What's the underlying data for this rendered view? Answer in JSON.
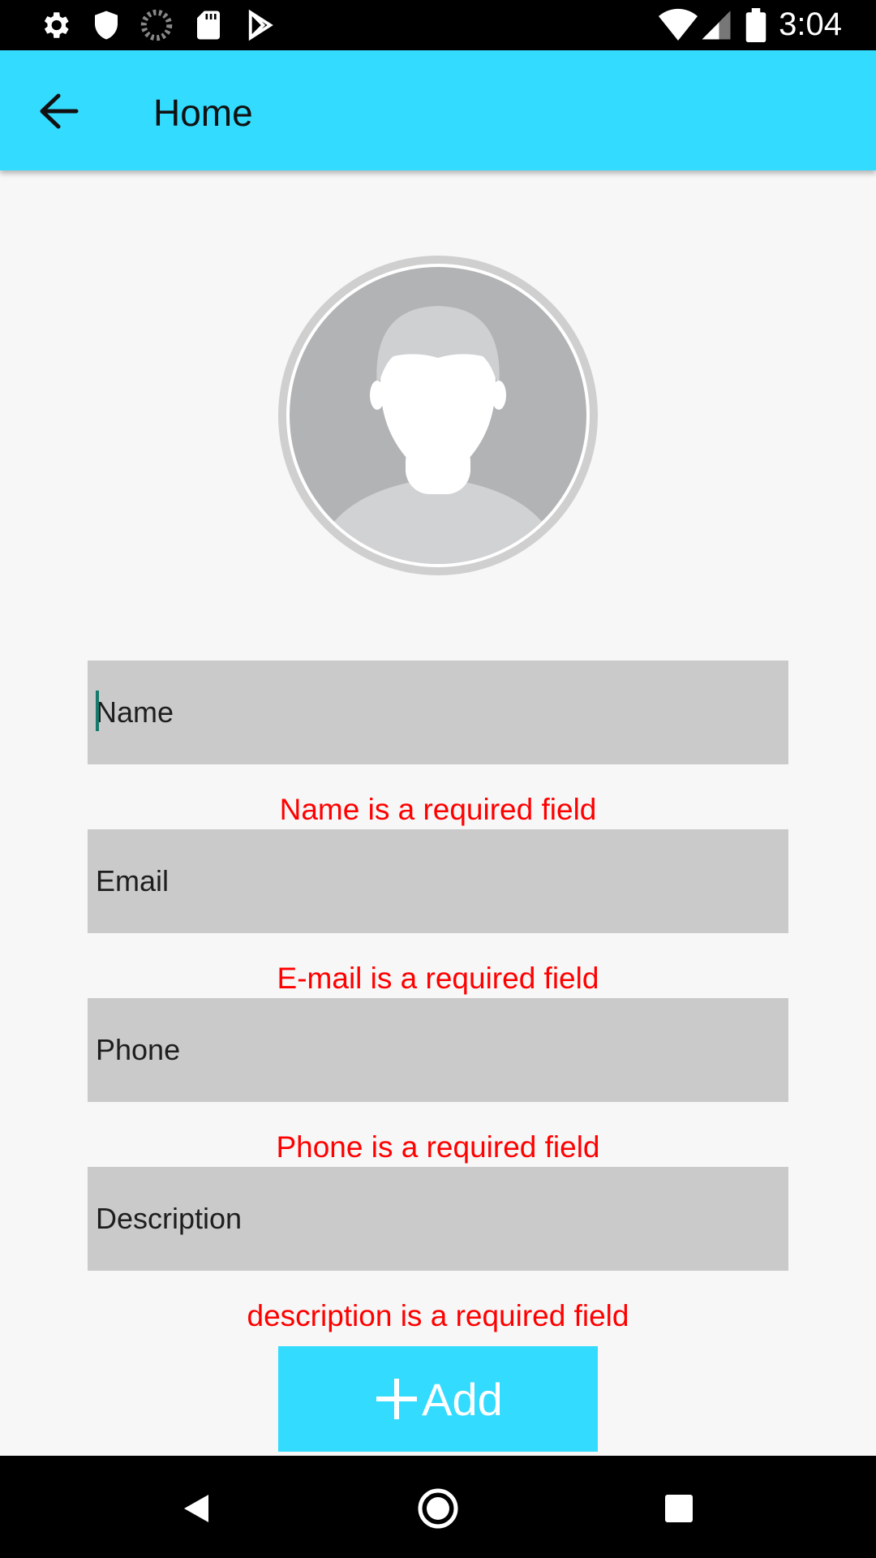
{
  "status_bar": {
    "time": "3:04",
    "left_icons": [
      "settings-icon",
      "shield-icon",
      "loading-icon",
      "sd-card-icon",
      "play-store-icon"
    ],
    "right_icons": [
      "wifi-icon",
      "signal-icon",
      "battery-icon"
    ]
  },
  "app_bar": {
    "title": "Home",
    "back_icon": "arrow-back-icon",
    "color": "#33dbff"
  },
  "form": {
    "fields": [
      {
        "placeholder": "Name",
        "value": "",
        "error": "Name is a required field"
      },
      {
        "placeholder": "Email",
        "value": "",
        "error": "E-mail is a required field"
      },
      {
        "placeholder": "Phone",
        "value": "",
        "error": "Phone is a required field"
      },
      {
        "placeholder": "Description",
        "value": "",
        "error": "description is a required field"
      }
    ],
    "error_color": "#ff0000",
    "add_button": {
      "label": "Add",
      "icon": "plus-icon"
    }
  },
  "nav_bar": {
    "icons": [
      "nav-back-icon",
      "nav-home-icon",
      "nav-recents-icon"
    ]
  }
}
